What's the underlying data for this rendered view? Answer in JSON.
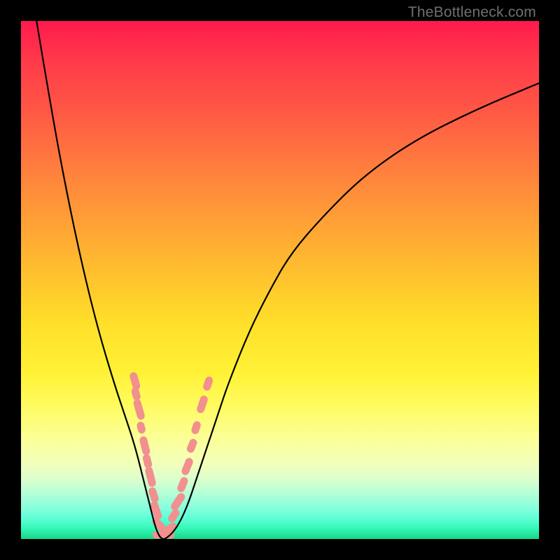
{
  "watermark": "TheBottleneck.com",
  "chart_data": {
    "type": "line",
    "title": "",
    "xlabel": "",
    "ylabel": "",
    "xlim": [
      0,
      100
    ],
    "ylim": [
      0,
      100
    ],
    "grid": false,
    "legend": false,
    "series": [
      {
        "name": "bottleneck-curve",
        "x": [
          3,
          6,
          9,
          12,
          15,
          18,
          20,
          22,
          24,
          25,
          26,
          27,
          28,
          30,
          32,
          34,
          36,
          38,
          40,
          44,
          48,
          52,
          58,
          66,
          76,
          88,
          100
        ],
        "y": [
          100,
          82,
          66,
          52,
          40,
          30,
          24,
          18,
          10,
          6,
          2,
          0,
          0,
          2,
          6,
          12,
          18,
          24,
          30,
          40,
          48,
          55,
          62,
          70,
          77,
          83,
          88
        ]
      }
    ],
    "curve_min_x": 27.5,
    "annotations": {
      "marker_cluster_color": "#f28f8f",
      "markers_left": [
        {
          "x": 22.0,
          "y": 30.5,
          "len": 3.0
        },
        {
          "x": 22.2,
          "y": 28.0,
          "len": 2.2
        },
        {
          "x": 22.8,
          "y": 25.0,
          "len": 3.5
        },
        {
          "x": 23.2,
          "y": 21.5,
          "len": 2.0
        },
        {
          "x": 23.9,
          "y": 18.0,
          "len": 3.2
        },
        {
          "x": 24.4,
          "y": 15.0,
          "len": 2.4
        },
        {
          "x": 25.0,
          "y": 12.0,
          "len": 3.4
        },
        {
          "x": 25.6,
          "y": 8.5,
          "len": 2.6
        },
        {
          "x": 26.1,
          "y": 5.5,
          "len": 3.2
        },
        {
          "x": 26.6,
          "y": 2.8,
          "len": 2.6
        }
      ],
      "markers_right": [
        {
          "x": 28.7,
          "y": 2.0,
          "len": 2.6
        },
        {
          "x": 29.5,
          "y": 4.5,
          "len": 2.4
        },
        {
          "x": 30.3,
          "y": 7.2,
          "len": 3.2
        },
        {
          "x": 31.2,
          "y": 10.5,
          "len": 2.6
        },
        {
          "x": 32.1,
          "y": 14.0,
          "len": 3.0
        },
        {
          "x": 33.0,
          "y": 18.0,
          "len": 2.4
        },
        {
          "x": 33.8,
          "y": 21.5,
          "len": 2.2
        },
        {
          "x": 35.0,
          "y": 26.0,
          "len": 3.0
        },
        {
          "x": 36.1,
          "y": 30.0,
          "len": 2.4
        }
      ],
      "markers_bottom": [
        {
          "x": 26.3,
          "y": 0.8
        },
        {
          "x": 27.1,
          "y": 0.8
        },
        {
          "x": 27.9,
          "y": 0.8
        },
        {
          "x": 28.7,
          "y": 0.8
        }
      ]
    }
  },
  "colors": {
    "curve": "#000000",
    "markers": "#f28f8f",
    "background_frame": "#000000"
  }
}
